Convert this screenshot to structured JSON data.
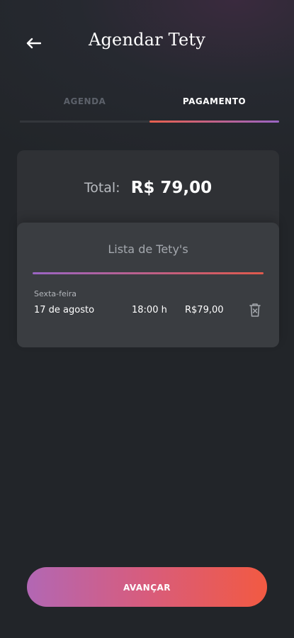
{
  "header": {
    "title": "Agendar Tety",
    "back_icon": "arrow-left-icon"
  },
  "tabs": [
    {
      "label": "AGENDA",
      "active": false
    },
    {
      "label": "PAGAMENTO",
      "active": true
    }
  ],
  "summary": {
    "total_label": "Total:",
    "total_value": "R$ 79,00"
  },
  "list": {
    "title": "Lista de Tety's",
    "items": [
      {
        "weekday": "Sexta-feira",
        "date": "17 de agosto",
        "time": "18:00 h",
        "price": "R$79,00",
        "delete_icon": "trash-icon"
      }
    ]
  },
  "actions": {
    "advance_label": "AVANÇAR"
  },
  "colors": {
    "background": "#222529",
    "card": "#2f3135",
    "list_card": "#3a3d41",
    "accent_start": "#b267b4",
    "accent_end": "#f25a42",
    "inactive_tab": "#5c616a"
  }
}
